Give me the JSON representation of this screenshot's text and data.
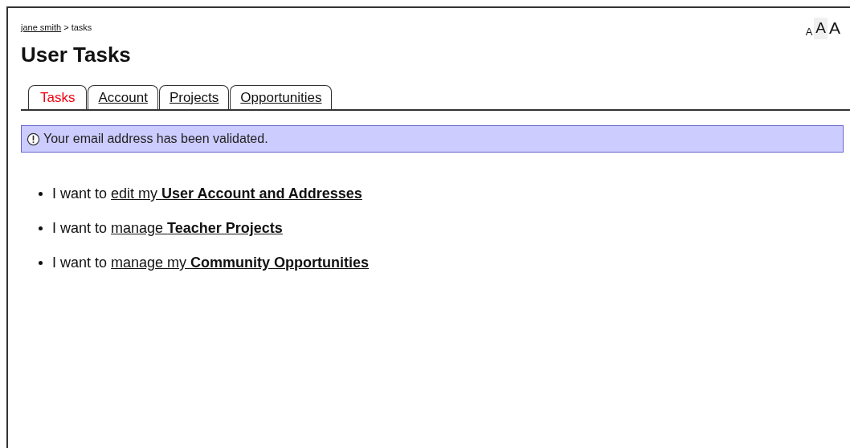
{
  "breadcrumb": {
    "link": "jane smith",
    "separator": ">",
    "current": "tasks"
  },
  "text_size_controls": [
    {
      "label": "A",
      "selected": false
    },
    {
      "label": "A",
      "selected": true
    },
    {
      "label": "A",
      "selected": false
    }
  ],
  "title": "User Tasks",
  "tabs": [
    {
      "label": "Tasks",
      "selected": true
    },
    {
      "label": "Account",
      "selected": false
    },
    {
      "label": "Projects",
      "selected": false
    },
    {
      "label": "Opportunities",
      "selected": false
    }
  ],
  "alert": {
    "message": "Your email address has been validated."
  },
  "tasks": [
    {
      "prefix": "I want to",
      "link": "edit my **User Account and Addresses**"
    },
    {
      "prefix": "I want to",
      "link": "manage **Teacher Projects**"
    },
    {
      "prefix": "I want to",
      "link": "manage my **Community Opportunities**"
    }
  ]
}
